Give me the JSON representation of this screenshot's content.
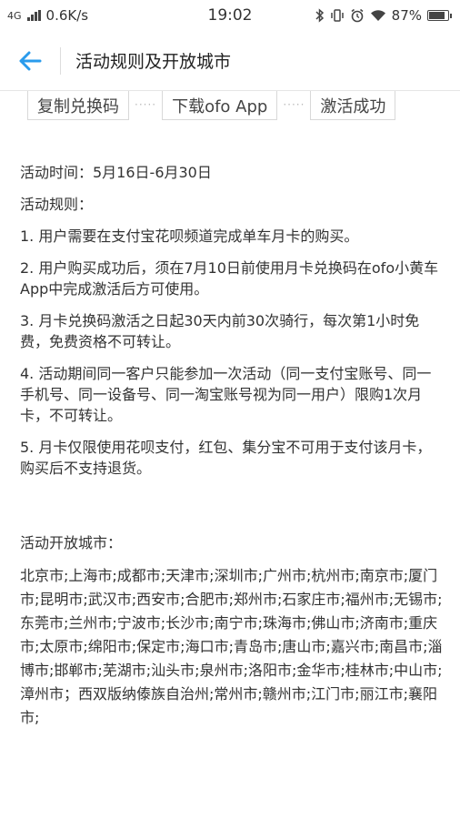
{
  "status_bar": {
    "network": "4G",
    "speed": "0.6K/s",
    "time": "19:02",
    "battery": "87%",
    "icons": [
      "bluetooth-icon",
      "vibrate-icon",
      "alarm-icon",
      "wifi-icon",
      "battery-icon"
    ]
  },
  "nav": {
    "back_icon": "arrow-left-icon",
    "title": "活动规则及开放城市",
    "accent_color": "#2a9bec"
  },
  "steps": [
    {
      "label": "复制兑换码"
    },
    {
      "label": "下载ofo App"
    },
    {
      "label": "激活成功"
    }
  ],
  "content": {
    "time": "活动时间：5月16日-6月30日",
    "rules_title": "活动规则：",
    "rules": [
      "1. 用户需要在支付宝花呗频道完成单车月卡的购买。",
      "2. 用户购买成功后，须在7月10日前使用月卡兑换码在ofo小黄车App中完成激活后方可使用。",
      "3. 月卡兑换码激活之日起30天内前30次骑行，每次第1小时免费，免费资格不可转让。",
      "4. 活动期间同一客户只能参加一次活动（同一支付宝账号、同一手机号、同一设备号、同一淘宝账号视为同一用户）限购1次月卡，不可转让。",
      "5. 月卡仅限使用花呗支付，红包、集分宝不可用于支付该月卡，购买后不支持退货。"
    ],
    "cities_title": "活动开放城市：",
    "cities": "北京市;上海市;成都市;天津市;深圳市;广州市;杭州市;南京市;厦门市;昆明市;武汉市;西安市;合肥市;郑州市;石家庄市;福州市;无锡市;东莞市;兰州市;宁波市;长沙市;南宁市;珠海市;佛山市;济南市;重庆市;太原市;绵阳市;保定市;海口市;青岛市;唐山市;嘉兴市;南昌市;淄博市;邯郸市;芜湖市;汕头市;泉州市;洛阳市;金华市;桂林市;中山市;漳州市；西双版纳傣族自治州;常州市;赣州市;江门市;丽江市;襄阳市;"
  }
}
